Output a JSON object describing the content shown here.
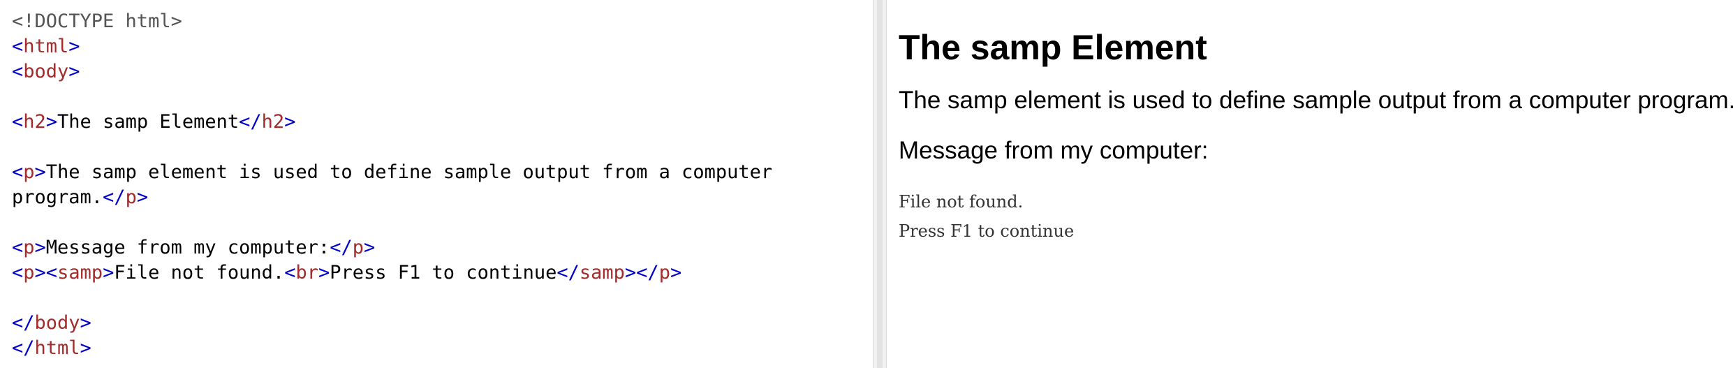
{
  "editor": {
    "lines": [
      [
        {
          "t": "<!DOCTYPE html>",
          "k": "doctype"
        }
      ],
      [
        {
          "t": "<",
          "k": "bracket"
        },
        {
          "t": "html",
          "k": "tag"
        },
        {
          "t": ">",
          "k": "bracket"
        }
      ],
      [
        {
          "t": "<",
          "k": "bracket"
        },
        {
          "t": "body",
          "k": "tag"
        },
        {
          "t": ">",
          "k": "bracket"
        }
      ],
      [],
      [
        {
          "t": "<",
          "k": "bracket"
        },
        {
          "t": "h2",
          "k": "tag"
        },
        {
          "t": ">",
          "k": "bracket"
        },
        {
          "t": "The samp Element",
          "k": "text"
        },
        {
          "t": "</",
          "k": "bracket"
        },
        {
          "t": "h2",
          "k": "tag"
        },
        {
          "t": ">",
          "k": "bracket"
        }
      ],
      [],
      [
        {
          "t": "<",
          "k": "bracket"
        },
        {
          "t": "p",
          "k": "tag"
        },
        {
          "t": ">",
          "k": "bracket"
        },
        {
          "t": "The samp element is used to define sample output from a computer",
          "k": "text"
        }
      ],
      [
        {
          "t": "program.",
          "k": "text"
        },
        {
          "t": "</",
          "k": "bracket"
        },
        {
          "t": "p",
          "k": "tag"
        },
        {
          "t": ">",
          "k": "bracket"
        }
      ],
      [],
      [
        {
          "t": "<",
          "k": "bracket"
        },
        {
          "t": "p",
          "k": "tag"
        },
        {
          "t": ">",
          "k": "bracket"
        },
        {
          "t": "Message from my computer:",
          "k": "text"
        },
        {
          "t": "</",
          "k": "bracket"
        },
        {
          "t": "p",
          "k": "tag"
        },
        {
          "t": ">",
          "k": "bracket"
        }
      ],
      [
        {
          "t": "<",
          "k": "bracket"
        },
        {
          "t": "p",
          "k": "tag"
        },
        {
          "t": ">",
          "k": "bracket"
        },
        {
          "t": "<",
          "k": "bracket"
        },
        {
          "t": "samp",
          "k": "tag"
        },
        {
          "t": ">",
          "k": "bracket"
        },
        {
          "t": "File not found.",
          "k": "text"
        },
        {
          "t": "<",
          "k": "bracket"
        },
        {
          "t": "br",
          "k": "tag"
        },
        {
          "t": ">",
          "k": "bracket"
        },
        {
          "t": "Press F1 to continue",
          "k": "text"
        },
        {
          "t": "</",
          "k": "bracket"
        },
        {
          "t": "samp",
          "k": "tag"
        },
        {
          "t": ">",
          "k": "bracket"
        },
        {
          "t": "</",
          "k": "bracket"
        },
        {
          "t": "p",
          "k": "tag"
        },
        {
          "t": ">",
          "k": "bracket"
        }
      ],
      [],
      [
        {
          "t": "</",
          "k": "bracket"
        },
        {
          "t": "body",
          "k": "tag"
        },
        {
          "t": ">",
          "k": "bracket"
        }
      ],
      [
        {
          "t": "</",
          "k": "bracket"
        },
        {
          "t": "html",
          "k": "tag"
        },
        {
          "t": ">",
          "k": "bracket"
        }
      ]
    ]
  },
  "result": {
    "heading": "The samp Element",
    "paragraph1": "The samp element is used to define sample output from a computer program.",
    "paragraph2": "Message from my computer:",
    "sample_line1": "File not found.",
    "sample_line2": "Press F1 to continue"
  },
  "colors": {
    "tag": "#a52a2a",
    "bracket": "#0000cd",
    "doctype": "#555555",
    "text": "#000000"
  }
}
